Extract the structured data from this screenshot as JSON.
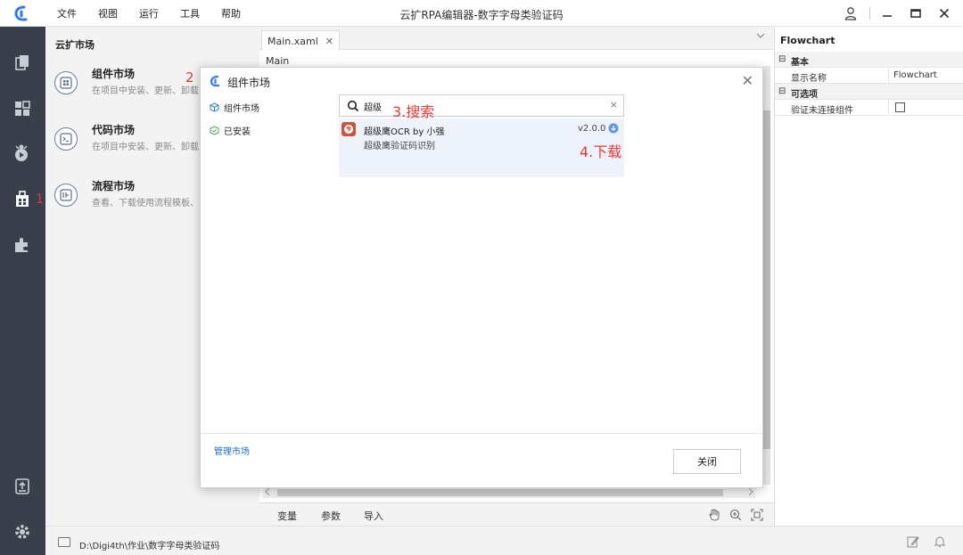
{
  "app": {
    "title": "云扩RPA编辑器-数字字母类验证码",
    "menu": [
      "文件",
      "视图",
      "运行",
      "工具",
      "帮助"
    ]
  },
  "colors": {
    "sidebar_bg": "#3a3f4c",
    "accent": "#1a6fc4",
    "annotation": "#e53935"
  },
  "market": {
    "title": "云扩市场",
    "items": [
      {
        "name": "组件市场",
        "desc": "在项目中安装、更新、卸载",
        "icon": "component-icon"
      },
      {
        "name": "代码市场",
        "desc": "在项目中安装、更新、卸载",
        "icon": "code-icon"
      },
      {
        "name": "流程市场",
        "desc": "查看、下载使用流程模板、",
        "icon": "flow-icon"
      }
    ]
  },
  "annotations": {
    "a1": "1",
    "a2": "2",
    "a3": "3.搜索",
    "a4": "4.下载"
  },
  "editor": {
    "tab": "Main.xaml",
    "tab_close": "✕",
    "breadcrumb": "Main",
    "bottom_tabs": [
      "变量",
      "参数",
      "导入"
    ]
  },
  "properties": {
    "title": "Flowchart",
    "sections": [
      {
        "label": "基本",
        "expander": "⊟",
        "rows": [
          {
            "key": "显示名称",
            "value": "Flowchart"
          }
        ]
      },
      {
        "label": "可选项",
        "expander": "⊟",
        "rows": [
          {
            "key": "验证未连接组件",
            "value": ""
          }
        ]
      }
    ]
  },
  "status": {
    "path": "D:\\Digi4th\\作业\\数字字母类验证码"
  },
  "modal": {
    "title": "组件市场",
    "close": "✕",
    "nav": [
      {
        "label": "组件市场",
        "icon": "cube-icon"
      },
      {
        "label": "已安装",
        "icon": "check-shield-icon"
      }
    ],
    "manage_link": "管理市场",
    "search_value": "超级",
    "search_clear": "×",
    "result": {
      "name": "超级鹰OCR  by  小强",
      "desc": "超级鹰验证码识别",
      "version": "v2.0.0"
    },
    "close_button": "关闭"
  }
}
